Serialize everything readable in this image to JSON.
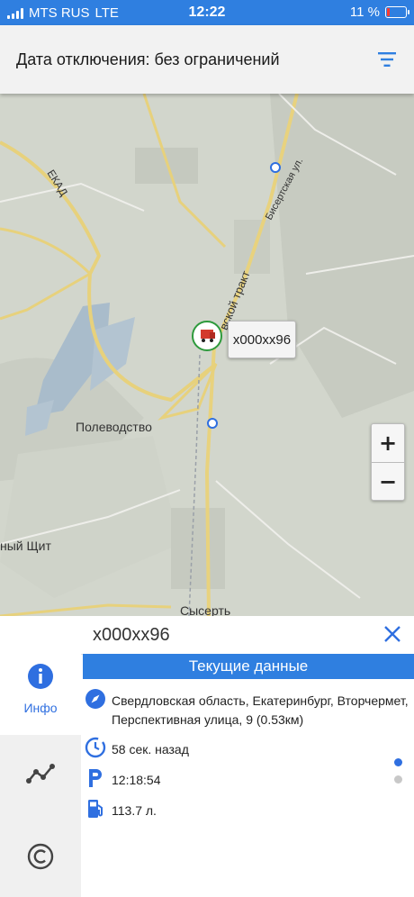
{
  "status_bar": {
    "carrier": "MTS RUS",
    "network": "LTE",
    "time": "12:22",
    "battery": "11 %"
  },
  "header": {
    "title": "Дата отключения: без ограничений",
    "filter_icon": "filter-icon"
  },
  "map": {
    "labels": {
      "ekad": "ЕКАД",
      "bisertskaya": "Бисертская ул.",
      "trakt": "вской тракт",
      "polevodstvo": "Полеводство",
      "shchit": "ный Щит",
      "sysert": "Сысерть"
    },
    "vehicle_label": "x000xx96",
    "zoom_in": "+",
    "zoom_out": "−"
  },
  "panel": {
    "title": "x000xx96",
    "close_icon": "close-icon",
    "tabs": [
      {
        "label": "Инфо",
        "icon": "info-icon"
      },
      {
        "label": "",
        "icon": "track-icon"
      },
      {
        "label": "",
        "icon": "copyright-icon"
      }
    ],
    "section_title": "Текущие данные",
    "rows": [
      {
        "icon": "compass-icon",
        "text": "Свердловская область, Екатеринбург, Вторчермет, Перспективная улица, 9 (0.53км)"
      },
      {
        "icon": "timer-icon",
        "text": "58 сек. назад"
      },
      {
        "icon": "parking-icon",
        "text": "12:18:54"
      },
      {
        "icon": "fuel-icon",
        "text": "113.7 л."
      }
    ]
  },
  "colors": {
    "accent": "#2f7fe0",
    "active_tab": "#2f6fe0",
    "dot_active": "#2f6fe0",
    "dot_inactive": "#c8c8c8"
  }
}
